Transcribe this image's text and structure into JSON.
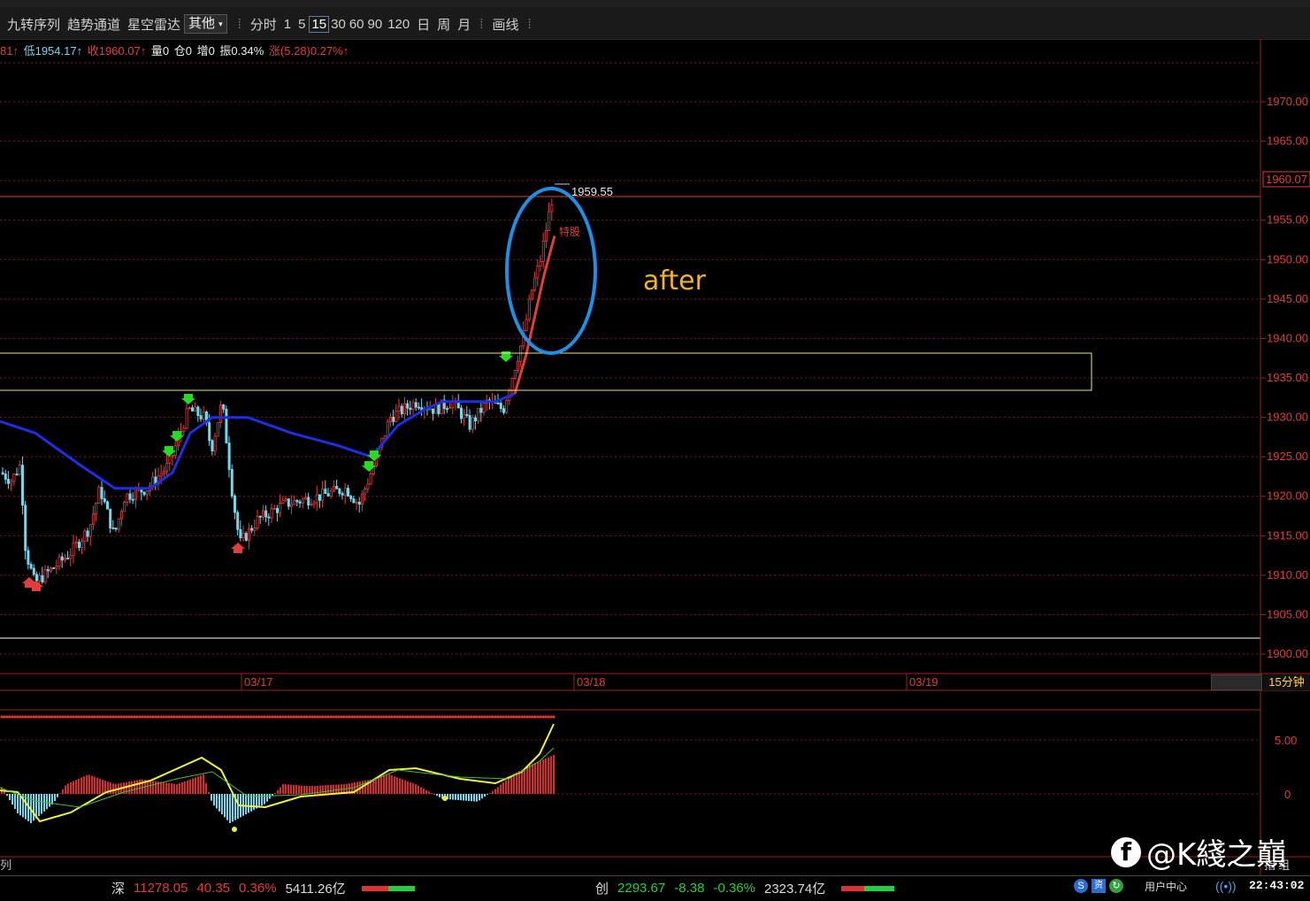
{
  "toolbar": {
    "items": [
      "九转序列",
      "趋势通道",
      "星空雷达"
    ],
    "select_value": "其他",
    "periods": [
      "分时",
      "1",
      "5",
      "15",
      "30",
      "60",
      "90",
      "120",
      "日",
      "周",
      "月"
    ],
    "active_period": "15",
    "draw_label": "画线"
  },
  "info": {
    "high": "81↑",
    "low": "低1954.17↑",
    "close": "收1960.07↑",
    "vol": "量0",
    "pos": "仓0",
    "inc": "增0",
    "amp": "振0.34%",
    "chg": "涨(5.28)0.27%↑"
  },
  "price_axis": {
    "labels": [
      "1970.00",
      "1965.00",
      "1955.00",
      "1950.00",
      "1945.00",
      "1940.00",
      "1935.00",
      "1930.00",
      "1925.00",
      "1920.00",
      "1915.00",
      "1910.00",
      "1905.00",
      "1900.00"
    ],
    "current": "1960.07"
  },
  "date_axis": [
    "03/17",
    "03/18",
    "03/19"
  ],
  "period_label": "15分钟",
  "annotations": {
    "last_price": "1959.55",
    "tag": "特股",
    "after": "after"
  },
  "indicator_axis": [
    "5.00",
    "0"
  ],
  "side_tabs": [
    "指",
    "组"
  ],
  "left_tab": "列",
  "status": {
    "sz_name": "深",
    "sz_index": "11278.05",
    "sz_chg": "40.35",
    "sz_pct": "0.36%",
    "sz_amt": "5411.26亿",
    "cy_name": "创",
    "cy_index": "2293.67",
    "cy_chg": "-8.38",
    "cy_pct": "-0.36%",
    "cy_amt": "2323.74亿",
    "user_center": "用户中心",
    "time": "22:43:02"
  },
  "watermark": "@K綫之巔",
  "colors": {
    "up": "#e23c3c",
    "down": "#6fd8ee",
    "ma": "#1b2fe6",
    "box": "#e8e880",
    "circle": "#1f8fe6",
    "after_text": "#f2b41c"
  }
}
